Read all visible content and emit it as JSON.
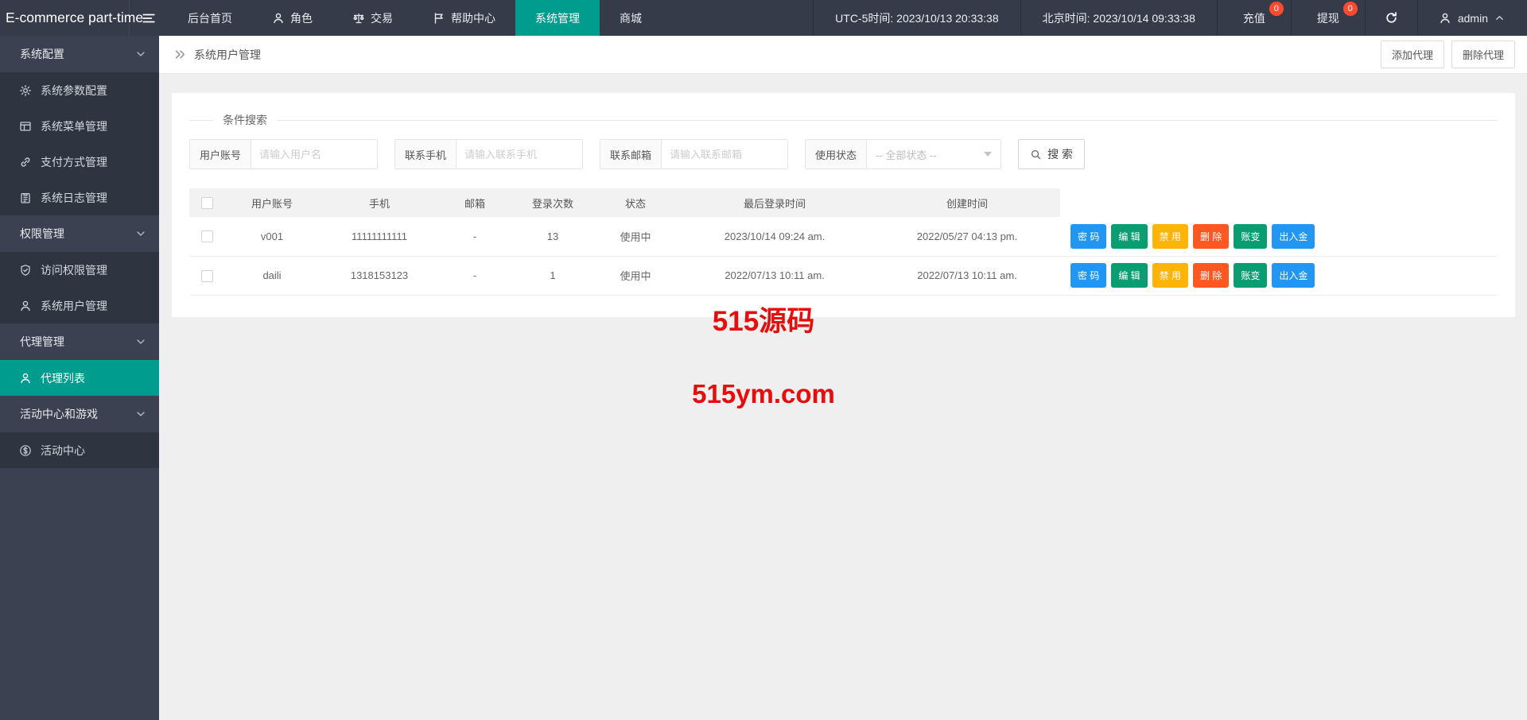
{
  "navbar": {
    "logo": "E-commerce part-time",
    "menu": [
      {
        "key": "home",
        "label": "后台首页",
        "icon": null,
        "active": false
      },
      {
        "key": "role",
        "label": "角色",
        "icon": "person-icon",
        "active": false
      },
      {
        "key": "trade",
        "label": "交易",
        "icon": "scales-icon",
        "active": false
      },
      {
        "key": "help",
        "label": "帮助中心",
        "icon": "flag-icon",
        "active": false
      },
      {
        "key": "system",
        "label": "系统管理",
        "icon": null,
        "active": true
      },
      {
        "key": "mall",
        "label": "商城",
        "icon": null,
        "active": false
      }
    ],
    "utc_time": "UTC-5时间: 2023/10/13 20:33:38",
    "beijing_time": "北京时间: 2023/10/14 09:33:38",
    "recharge": {
      "label": "充值",
      "badge": "0"
    },
    "withdraw": {
      "label": "提现",
      "badge": "0"
    },
    "user": "admin"
  },
  "sidebar": {
    "sections": [
      {
        "key": "system-config",
        "header": "系统配置",
        "items": [
          {
            "key": "system-params",
            "icon": "gear-icon",
            "label": "系统参数配置",
            "active": false
          },
          {
            "key": "system-menu",
            "icon": "window-icon",
            "label": "系统菜单管理",
            "active": false
          },
          {
            "key": "payment-method",
            "icon": "link-icon",
            "label": "支付方式管理",
            "active": false
          },
          {
            "key": "system-log",
            "icon": "clipboard-icon",
            "label": "系统日志管理",
            "active": false
          }
        ]
      },
      {
        "key": "permission",
        "header": "权限管理",
        "items": [
          {
            "key": "access-permission",
            "icon": "shield-check-icon",
            "label": "访问权限管理",
            "active": false
          },
          {
            "key": "system-user",
            "icon": "person-icon",
            "label": "系统用户管理",
            "active": false
          }
        ]
      },
      {
        "key": "agent",
        "header": "代理管理",
        "items": [
          {
            "key": "agent-list",
            "icon": "person-icon",
            "label": "代理列表",
            "active": true
          }
        ]
      },
      {
        "key": "activity",
        "header": "活动中心和游戏",
        "items": [
          {
            "key": "activity-center",
            "icon": "dollar-icon",
            "label": "活动中心",
            "active": false
          }
        ]
      }
    ]
  },
  "breadcrumb": {
    "title": "系统用户管理"
  },
  "page_actions": {
    "add": "添加代理",
    "delete": "删除代理"
  },
  "search": {
    "legend": "条件搜索",
    "fields": [
      {
        "key": "account",
        "label": "用户账号",
        "placeholder": "请输入用户名",
        "value": ""
      },
      {
        "key": "phone",
        "label": "联系手机",
        "placeholder": "请输入联系手机",
        "value": ""
      },
      {
        "key": "email",
        "label": "联系邮箱",
        "placeholder": "请输入联系邮箱",
        "value": ""
      }
    ],
    "status": {
      "label": "使用状态",
      "value": "-- 全部状态 --"
    },
    "button": "搜 索"
  },
  "table": {
    "headers": [
      "用户账号",
      "手机",
      "邮箱",
      "登录次数",
      "状态",
      "最后登录时间",
      "创建时间"
    ],
    "rows": [
      {
        "account": "v001",
        "phone": "11111111111",
        "email": "-",
        "logins": "13",
        "status": "使用中",
        "last_login": "2023/10/14 09:24 am.",
        "created": "2022/05/27 04:13 pm."
      },
      {
        "account": "daili",
        "phone": "1318153123",
        "email": "-",
        "logins": "1",
        "status": "使用中",
        "last_login": "2022/07/13 10:11 am.",
        "created": "2022/07/13 10:11 am."
      }
    ],
    "actions": [
      {
        "key": "password",
        "label": "密 码",
        "color": "blue"
      },
      {
        "key": "edit",
        "label": "编 辑",
        "color": "green"
      },
      {
        "key": "disable",
        "label": "禁 用",
        "color": "amber"
      },
      {
        "key": "delete",
        "label": "删 除",
        "color": "red"
      },
      {
        "key": "account-change",
        "label": "账变",
        "color": "green"
      },
      {
        "key": "funds",
        "label": "出入金",
        "color": "blue"
      }
    ]
  },
  "watermark": {
    "line1": "515源码",
    "line2": "515ym.com"
  },
  "colors": {
    "accent_teal": "#009c8e",
    "navbar_bg": "#353b48",
    "sidebar_bg": "#3b4150",
    "sidebar_item_bg": "#2f3540",
    "badge_red": "#ff4a30",
    "status_green": "#23a51f",
    "watermark_red": "#e60d0d",
    "btn_blue": "#2196f3",
    "btn_green": "#0a9d72",
    "btn_amber": "#fdb408",
    "btn_red": "#ff5722"
  }
}
